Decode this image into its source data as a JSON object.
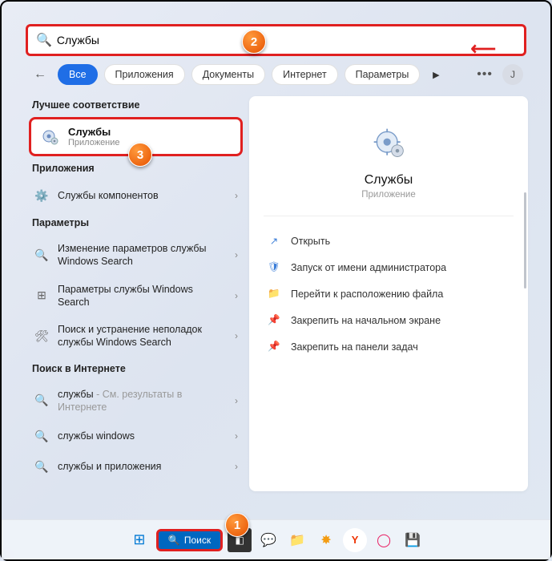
{
  "search": {
    "value": "Службы"
  },
  "tabs": {
    "back": "←",
    "all": "Все",
    "apps": "Приложения",
    "docs": "Документы",
    "web": "Интернет",
    "params": "Параметры"
  },
  "avatar": "J",
  "left": {
    "best_h": "Лучшее соответствие",
    "best": {
      "title": "Службы",
      "sub": "Приложение"
    },
    "apps_h": "Приложения",
    "app1": "Службы компонентов",
    "params_h": "Параметры",
    "p1": "Изменение параметров службы Windows Search",
    "p2": "Параметры службы Windows Search",
    "p3": "Поиск и устранение неполадок службы Windows Search",
    "web_h": "Поиск в Интернете",
    "w1_a": "службы",
    "w1_b": " - См. результаты в Интернете",
    "w2": "службы windows",
    "w3": "службы и приложения"
  },
  "preview": {
    "title": "Службы",
    "sub": "Приложение",
    "a1": "Открыть",
    "a2": "Запуск от имени администратора",
    "a3": "Перейти к расположению файла",
    "a4": "Закрепить на начальном экране",
    "a5": "Закрепить на панели задач"
  },
  "taskbar": {
    "search": "Поиск"
  },
  "badges": {
    "b1": "1",
    "b2": "2",
    "b3": "3"
  }
}
